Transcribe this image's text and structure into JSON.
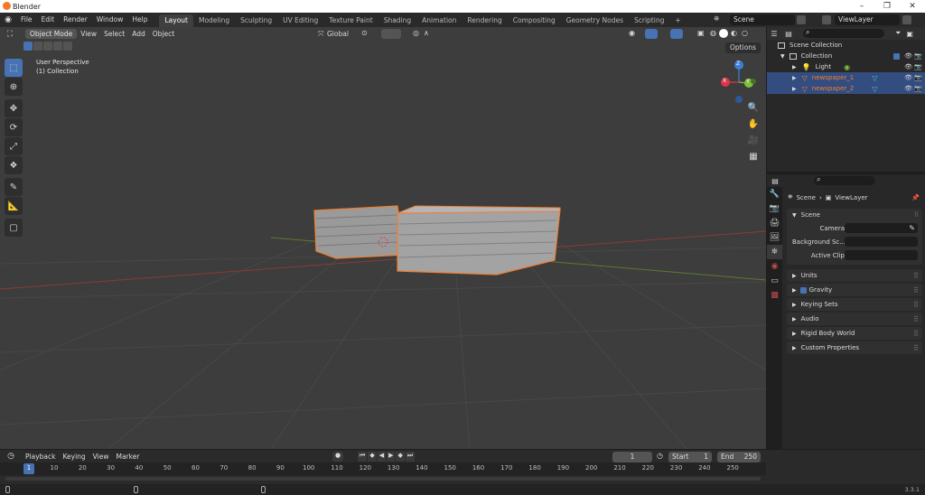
{
  "window": {
    "title": "Blender",
    "buttons": [
      "–",
      "❐",
      "✕"
    ]
  },
  "menus": [
    "File",
    "Edit",
    "Render",
    "Window",
    "Help"
  ],
  "workspaces": [
    "Layout",
    "Modeling",
    "Sculpting",
    "UV Editing",
    "Texture Paint",
    "Shading",
    "Animation",
    "Rendering",
    "Compositing",
    "Geometry Nodes",
    "Scripting"
  ],
  "active_workspace": "Layout",
  "add_workspace": "+",
  "scene": {
    "label": "Scene",
    "viewlayer": "ViewLayer"
  },
  "viewport": {
    "mode": "Object Mode",
    "menus": [
      "View",
      "Select",
      "Add",
      "Object"
    ],
    "transform": "Global",
    "options": "Options",
    "perspective": "User Perspective",
    "collection": "(1) Collection",
    "gizmo": {
      "x": "X",
      "y": "Y",
      "z": "Z"
    }
  },
  "tools": [
    "select-box-icon",
    "cursor-icon",
    "move-icon",
    "rotate-icon",
    "scale-icon",
    "transform-icon",
    "annotate-icon",
    "measure-icon",
    "add-cube-icon"
  ],
  "outliner": {
    "search_placeholder": "",
    "rows": [
      {
        "label": "Scene Collection",
        "indent": 0,
        "selected": false
      },
      {
        "label": "Collection",
        "indent": 1,
        "selected": false
      },
      {
        "label": "Light",
        "indent": 2,
        "selected": false
      },
      {
        "label": "newspaper_1",
        "indent": 2,
        "selected": true
      },
      {
        "label": "newspaper_2",
        "indent": 2,
        "selected": true
      }
    ]
  },
  "properties": {
    "breadcrumb": {
      "scene": "Scene",
      "viewlayer": "ViewLayer"
    },
    "scene_panel": "Scene",
    "fields": [
      {
        "label": "Camera"
      },
      {
        "label": "Background Sc..."
      },
      {
        "label": "Active Clip"
      }
    ],
    "panels": [
      "Units",
      "Gravity",
      "Keying Sets",
      "Audio",
      "Rigid Body World",
      "Custom Properties"
    ]
  },
  "timeline": {
    "menus": [
      "Playback",
      "Keying",
      "View",
      "Marker"
    ],
    "current_frame": "1",
    "start_label": "Start",
    "start": "1",
    "end_label": "End",
    "end": "250",
    "ruler": [
      "1",
      "10",
      "20",
      "30",
      "40",
      "50",
      "60",
      "70",
      "80",
      "90",
      "100",
      "110",
      "120",
      "130",
      "140",
      "150",
      "160",
      "170",
      "180",
      "190",
      "200",
      "210",
      "220",
      "230",
      "240",
      "250"
    ]
  },
  "version": "3.3.1",
  "colors": {
    "accent": "#4772b3",
    "selection_orange": "#f07f2f",
    "axis_x": "#e0344b",
    "axis_y": "#7ec13a",
    "axis_z": "#3b7fd6"
  }
}
